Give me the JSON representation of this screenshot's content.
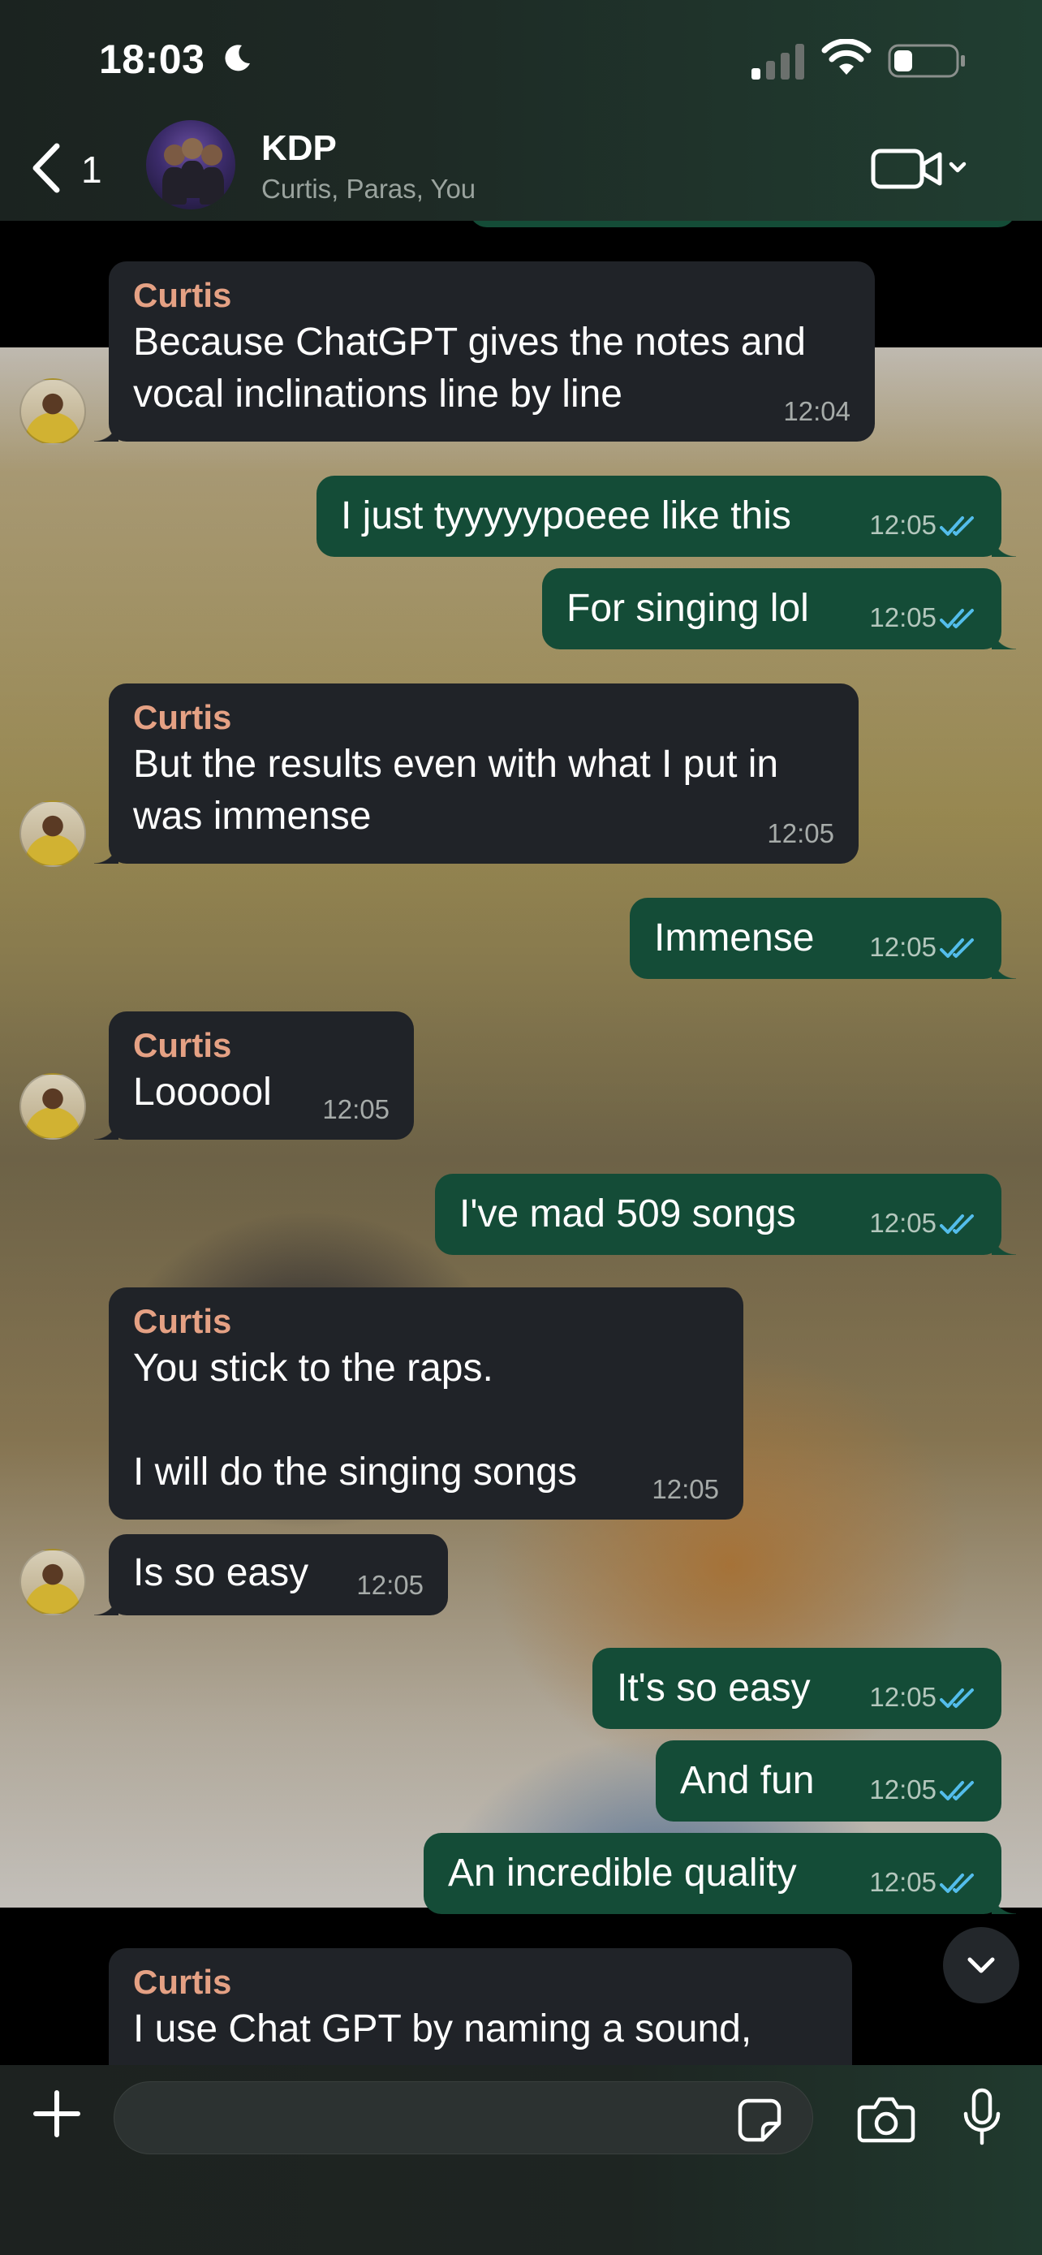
{
  "status_bar": {
    "time": "18:03"
  },
  "header": {
    "back_count": "1",
    "title": "KDP",
    "subtitle": "Curtis, Paras, You"
  },
  "messages": [
    {
      "direction": "in",
      "sender": "Curtis",
      "text": "Because ChatGPT gives the notes and\nvocal inclinations line by line",
      "time": "12:04"
    },
    {
      "direction": "out",
      "text": "I just tyyyyypoeee like this",
      "time": "12:05",
      "status": "read"
    },
    {
      "direction": "out",
      "text": "For singing lol",
      "time": "12:05",
      "status": "read"
    },
    {
      "direction": "in",
      "sender": "Curtis",
      "text": "But the results even with what I put in\nwas immense",
      "time": "12:05"
    },
    {
      "direction": "out",
      "text": "Immense",
      "time": "12:05",
      "status": "read"
    },
    {
      "direction": "in",
      "sender": "Curtis",
      "text": "Loooool",
      "time": "12:05"
    },
    {
      "direction": "out",
      "text": "I've mad 509 songs",
      "time": "12:05",
      "status": "read"
    },
    {
      "direction": "in",
      "sender": "Curtis",
      "text": "You stick to the raps.\n\nI will do the singing songs",
      "time": "12:05"
    },
    {
      "direction": "in",
      "text": "Is so easy",
      "time": "12:05"
    },
    {
      "direction": "out",
      "text": "It's so easy",
      "time": "12:05",
      "status": "read"
    },
    {
      "direction": "out",
      "text": "And fun",
      "time": "12:05",
      "status": "read"
    },
    {
      "direction": "out",
      "text": "An incredible quality",
      "time": "12:05",
      "status": "read"
    },
    {
      "direction": "in",
      "sender": "Curtis",
      "text": "I use Chat GPT by naming a sound,",
      "time": ""
    }
  ],
  "composer": {
    "value": ""
  },
  "colors": {
    "incoming_bubble": "#202328",
    "outgoing_bubble": "#144c37",
    "sender_name": "#e5a184",
    "read_ticks": "#53bdeb"
  },
  "icons": [
    "moon-icon",
    "signal-icon",
    "wifi-icon",
    "battery-icon",
    "chevron-left-icon",
    "video-call-icon",
    "chevron-down-icon",
    "double-check-icon",
    "plus-icon",
    "sticker-icon",
    "camera-icon",
    "microphone-icon"
  ]
}
